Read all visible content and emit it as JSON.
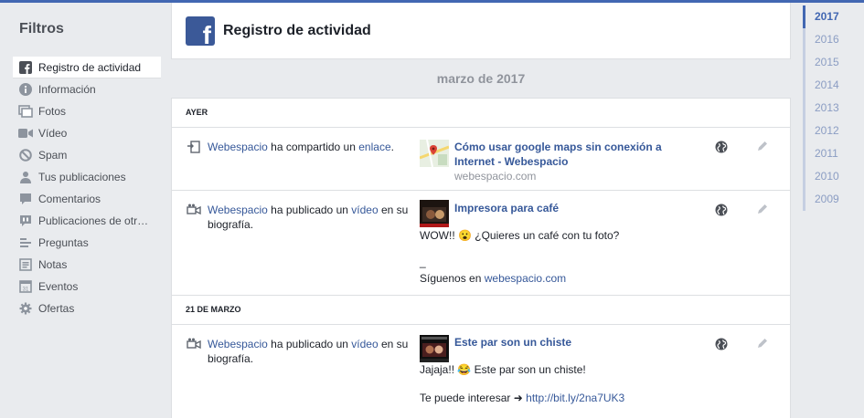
{
  "sidebar": {
    "title": "Filtros",
    "items": [
      {
        "label": "Registro de actividad",
        "icon": "facebook-icon"
      },
      {
        "label": "Información",
        "icon": "info-icon"
      },
      {
        "label": "Fotos",
        "icon": "photos-icon"
      },
      {
        "label": "Vídeo",
        "icon": "video-icon"
      },
      {
        "label": "Spam",
        "icon": "block-icon"
      },
      {
        "label": "Tus publicaciones",
        "icon": "person-icon"
      },
      {
        "label": "Comentarios",
        "icon": "comment-icon"
      },
      {
        "label": "Publicaciones de otr…",
        "icon": "others-posts-icon"
      },
      {
        "label": "Preguntas",
        "icon": "questions-icon"
      },
      {
        "label": "Notas",
        "icon": "notes-icon"
      },
      {
        "label": "Eventos",
        "icon": "calendar-icon"
      },
      {
        "label": "Ofertas",
        "icon": "offers-gear-icon"
      }
    ]
  },
  "header": {
    "title": "Registro de actividad"
  },
  "month": "marzo de 2017",
  "sections": [
    {
      "day": "Ayer",
      "entries": [
        {
          "actor": "Webespacio",
          "action": "ha compartido un",
          "object": "enlace",
          "post_title": "Cómo usar google maps sin conexión a Internet - Webespacio",
          "domain": "webespacio.com"
        },
        {
          "actor": "Webespacio",
          "action": "ha publicado un",
          "object": "vídeo",
          "suffix": "en su biografía.",
          "post_title": "Impresora para café",
          "text1": "WOW!! 😮 ¿Quieres un café con tu foto?",
          "text2": "_",
          "text3_prefix": "Síguenos en",
          "text3_link": "webespacio.com"
        }
      ]
    },
    {
      "day": "21 de marzo",
      "entries": [
        {
          "actor": "Webespacio",
          "action": "ha publicado un",
          "object": "vídeo",
          "suffix": "en su biografía.",
          "post_title": "Este par son un chiste",
          "text1": "Jajaja!! 😂 Este par son un chiste!",
          "text2_prefix": "Te puede interesar ➜",
          "text2_link": "http://bit.ly/2na7UK3"
        }
      ]
    }
  ],
  "years": [
    "2017",
    "2016",
    "2015",
    "2014",
    "2013",
    "2012",
    "2011",
    "2010",
    "2009"
  ],
  "colors": {
    "brand": "#3b5998",
    "link": "#365899",
    "background": "#e9ebee"
  }
}
